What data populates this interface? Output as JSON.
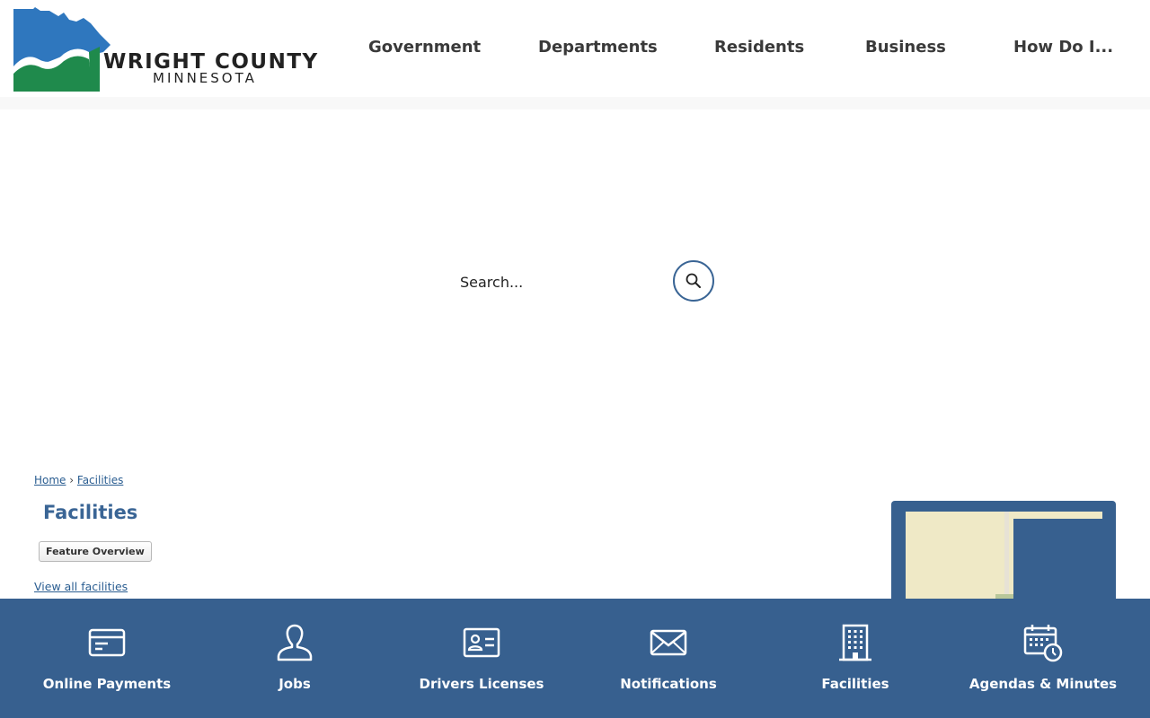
{
  "logo": {
    "title": "WRIGHT COUNTY",
    "subtitle": "MINNESOTA"
  },
  "nav": [
    {
      "label": "Government"
    },
    {
      "label": "Departments"
    },
    {
      "label": "Residents"
    },
    {
      "label": "Business"
    },
    {
      "label": "How Do I..."
    }
  ],
  "search": {
    "placeholder": "Search...",
    "icon": "search-icon"
  },
  "breadcrumb": {
    "home": "Home",
    "separator": "›",
    "current": "Facilities"
  },
  "page_title": "Facilities",
  "feature_button": "Feature Overview",
  "view_all": "View all facilities",
  "quick_links": [
    {
      "label": "Online Payments",
      "icon": "credit-card-icon"
    },
    {
      "label": "Jobs",
      "icon": "person-icon"
    },
    {
      "label": "Drivers Licenses",
      "icon": "id-card-icon"
    },
    {
      "label": "Notifications",
      "icon": "envelope-icon"
    },
    {
      "label": "Facilities",
      "icon": "building-icon"
    },
    {
      "label": "Agendas & Minutes",
      "icon": "calendar-clock-icon"
    }
  ],
  "colors": {
    "brand_blue": "#37608f",
    "logo_blue": "#2f77be",
    "logo_green": "#1f8a4c",
    "link": "#2a5d91"
  }
}
